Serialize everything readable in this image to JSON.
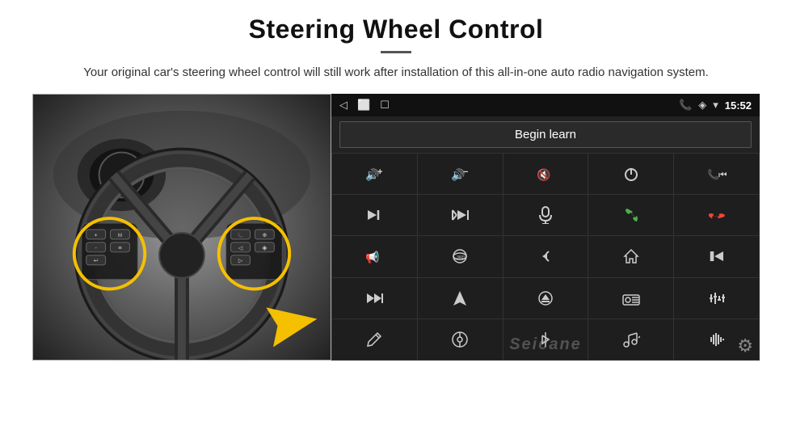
{
  "header": {
    "title": "Steering Wheel Control",
    "divider": true,
    "subtitle": "Your original car's steering wheel control will still work after installation of this all-in-one auto radio navigation system."
  },
  "android_panel": {
    "status_bar": {
      "back_icon": "◁",
      "home_icon": "⬜",
      "square_icon": "☐",
      "signal_icon": "▪▪",
      "phone_icon": "📞",
      "location_icon": "◈",
      "wifi_icon": "▾",
      "time": "15:52"
    },
    "begin_learn_label": "Begin learn",
    "controls": [
      {
        "icon": "🔊+",
        "unicode": ""
      },
      {
        "icon": "🔊-",
        "unicode": ""
      },
      {
        "icon": "🔇",
        "unicode": ""
      },
      {
        "icon": "⏻",
        "unicode": ""
      },
      {
        "icon": "📞⏭",
        "unicode": ""
      },
      {
        "icon": "⏭|",
        "unicode": ""
      },
      {
        "icon": "✂⏭",
        "unicode": ""
      },
      {
        "icon": "🎤",
        "unicode": ""
      },
      {
        "icon": "📞",
        "unicode": ""
      },
      {
        "icon": "↩📞",
        "unicode": ""
      },
      {
        "icon": "📢",
        "unicode": ""
      },
      {
        "icon": "360",
        "unicode": ""
      },
      {
        "icon": "↩",
        "unicode": ""
      },
      {
        "icon": "🏠",
        "unicode": ""
      },
      {
        "icon": "|⏮⏮",
        "unicode": ""
      },
      {
        "icon": "⏭⏭|",
        "unicode": ""
      },
      {
        "icon": "▶",
        "unicode": ""
      },
      {
        "icon": "⊕",
        "unicode": ""
      },
      {
        "icon": "📻",
        "unicode": ""
      },
      {
        "icon": "⚙",
        "unicode": ""
      },
      {
        "icon": "✏",
        "unicode": ""
      },
      {
        "icon": "🎯",
        "unicode": ""
      },
      {
        "icon": "✱",
        "unicode": ""
      },
      {
        "icon": "🎵",
        "unicode": ""
      },
      {
        "icon": "|||",
        "unicode": ""
      }
    ],
    "watermark": "Seicane",
    "gear_label": "⚙"
  }
}
